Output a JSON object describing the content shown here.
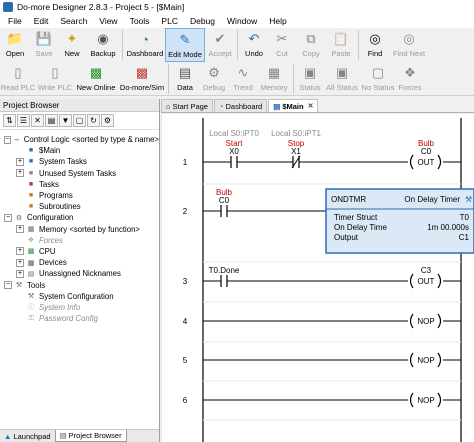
{
  "window": {
    "title": "Do-more Designer 2.8.3 - Project 5 - [$Main]"
  },
  "menu": [
    "File",
    "Edit",
    "Search",
    "View",
    "Tools",
    "PLC",
    "Debug",
    "Window",
    "Help"
  ],
  "toolbar1": {
    "open": "Open",
    "save": "Save",
    "new": "New",
    "backup": "Backup",
    "dashboard": "Dashboard",
    "edit_mode": "Edit Mode",
    "accept": "Accept",
    "undo": "Undo",
    "cut": "Cut",
    "copy": "Copy",
    "paste": "Paste",
    "find": "Find",
    "find_next": "Find Next"
  },
  "toolbar2": {
    "read_plc": "Read PLC",
    "write_plc": "Write PLC",
    "new_online": "New Online",
    "domore_sim": "Do-more/Sim",
    "data": "Data",
    "debug": "Debug",
    "trend": "Trend",
    "memory": "Memory",
    "status": "Status",
    "all_status": "All Status",
    "no_status": "No Status",
    "forces": "Forces"
  },
  "project_browser": {
    "header": "Project Browser",
    "nodes": [
      {
        "exp": "−",
        "indent": 0,
        "label": "Control Logic <sorted by type & name>",
        "dim": false
      },
      {
        "exp": "",
        "indent": 1,
        "label": "$Main",
        "dim": false
      },
      {
        "exp": "+",
        "indent": 1,
        "label": "System Tasks",
        "dim": false
      },
      {
        "exp": "+",
        "indent": 1,
        "label": "Unused System Tasks",
        "dim": false
      },
      {
        "exp": "",
        "indent": 1,
        "label": "Tasks",
        "dim": false
      },
      {
        "exp": "",
        "indent": 1,
        "label": "Programs",
        "dim": false
      },
      {
        "exp": "",
        "indent": 1,
        "label": "Subroutines",
        "dim": false
      },
      {
        "exp": "−",
        "indent": 0,
        "label": "Configuration",
        "dim": false
      },
      {
        "exp": "+",
        "indent": 1,
        "label": "Memory <sorted by function>",
        "dim": false
      },
      {
        "exp": "",
        "indent": 1,
        "label": "Forces",
        "dim": true
      },
      {
        "exp": "+",
        "indent": 1,
        "label": "CPU",
        "dim": false
      },
      {
        "exp": "+",
        "indent": 1,
        "label": "Devices",
        "dim": false
      },
      {
        "exp": "+",
        "indent": 1,
        "label": "Unassigned Nicknames",
        "dim": false
      },
      {
        "exp": "−",
        "indent": 0,
        "label": "Tools",
        "dim": false
      },
      {
        "exp": "",
        "indent": 1,
        "label": "System Configuration",
        "dim": false
      },
      {
        "exp": "",
        "indent": 1,
        "label": "System Info",
        "dim": true
      },
      {
        "exp": "",
        "indent": 1,
        "label": "Password Config",
        "dim": true
      }
    ],
    "bottom_tabs": [
      "Launchpad",
      "Project Browser"
    ]
  },
  "doc_tabs": [
    "Start Page",
    "Dashboard",
    "$Main"
  ],
  "ladder": {
    "rungs": [
      {
        "num": "1",
        "contacts": [
          {
            "nick": "Local S0:iPT0",
            "label": "Start",
            "addr": "X0",
            "type": "NO"
          },
          {
            "nick": "Local S0:iPT1",
            "label": "Stop",
            "addr": "X1",
            "type": "NC"
          }
        ],
        "coil": {
          "label": "Bulb",
          "addr": "C0",
          "instr": "OUT"
        }
      },
      {
        "num": "2",
        "contacts": [
          {
            "label": "Bulb",
            "addr": "C0",
            "type": "NO"
          }
        ],
        "box": {
          "name": "ONDTMR",
          "title": "On Delay Timer",
          "rows": [
            {
              "k": "Timer Struct",
              "v": "T0"
            },
            {
              "k": "On Delay Time",
              "v": "1m 00.000s"
            },
            {
              "k": "Output",
              "v": "C1"
            }
          ]
        }
      },
      {
        "num": "3",
        "contacts": [
          {
            "label": "T0.Done",
            "type": "NO"
          }
        ],
        "coil": {
          "addr": "C3",
          "instr": "OUT"
        }
      },
      {
        "num": "4",
        "coil": {
          "instr": "NOP"
        }
      },
      {
        "num": "5",
        "coil": {
          "instr": "NOP"
        }
      },
      {
        "num": "6",
        "coil": {
          "instr": "NOP"
        }
      }
    ]
  },
  "colors": {
    "accent": "#2b6cb0",
    "timer_box": "#dbe9f7",
    "timer_border": "#2a6fb5",
    "label_red": "#c00000"
  }
}
